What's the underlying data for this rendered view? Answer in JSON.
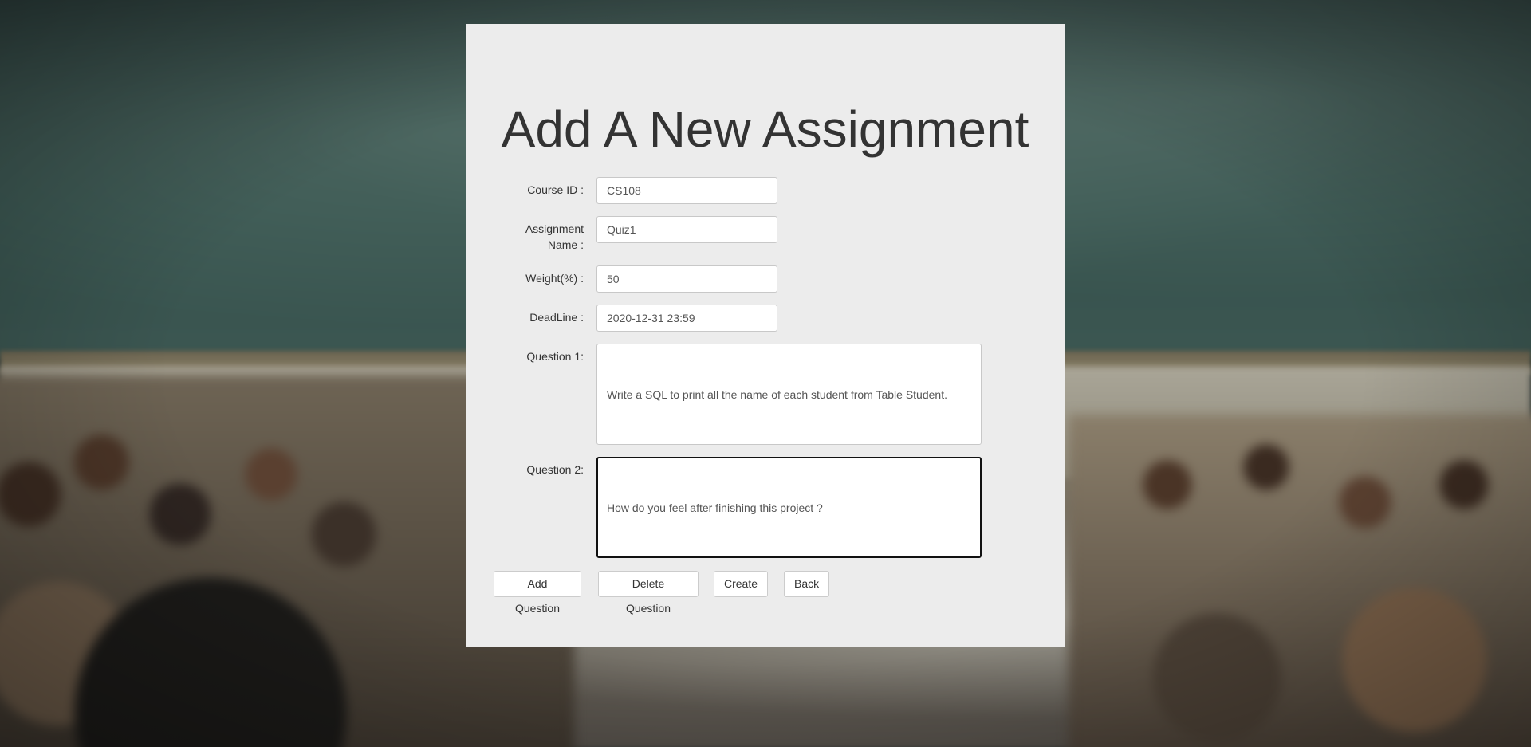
{
  "page": {
    "title": "Add A New Assignment"
  },
  "form": {
    "course_id": {
      "label": "Course ID :",
      "value": "CS108"
    },
    "assignment_name": {
      "label_line1": "Assignment",
      "label_line2": "Name :",
      "value": "Quiz1"
    },
    "weight": {
      "label": "Weight(%) :",
      "value": "50"
    },
    "deadline": {
      "label": "DeadLine :",
      "value": "2020-12-31 23:59"
    },
    "questions": [
      {
        "label": "Question 1:",
        "value": "Write a SQL to print all the name of each student from Table Student."
      },
      {
        "label": "Question 2:",
        "value": "How do you feel after finishing this project ?"
      }
    ]
  },
  "actions": {
    "add_question": "Add Question",
    "delete_question": "Delete Question",
    "create": "Create",
    "back": "Back"
  }
}
